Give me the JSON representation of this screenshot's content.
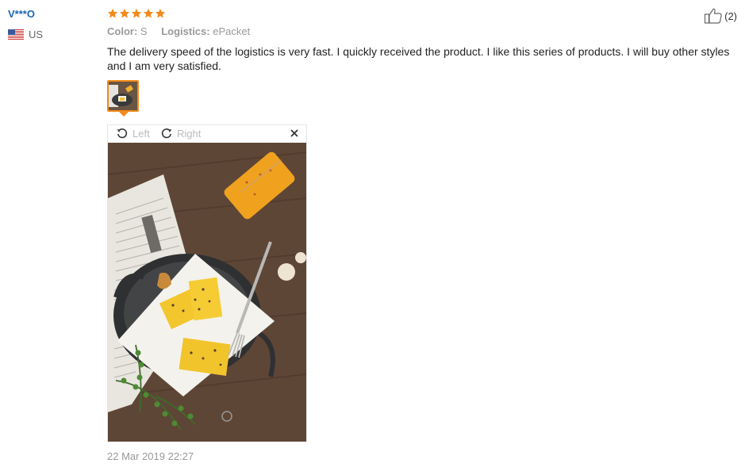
{
  "user": {
    "name": "V***O",
    "country": "US",
    "flag": "us-flag-icon"
  },
  "rating": {
    "stars": 5,
    "max": 5,
    "color": "#f28a1c"
  },
  "meta": {
    "color_label": "Color:",
    "color_value": "S",
    "logistics_label": "Logistics:",
    "logistics_value": "ePacket"
  },
  "review": {
    "text": "The delivery speed of the logistics is very fast. I quickly received the product. I like this series of products. I will buy other styles and I am very satisfied."
  },
  "helpful": {
    "count": "(2)",
    "icon": "thumbs-up-icon"
  },
  "viewer": {
    "rotate_left": "Left",
    "rotate_right": "Right",
    "close_icon": "close-icon"
  },
  "timestamp": "22 Mar 2019 22:27",
  "colors": {
    "accent": "#f28a1c",
    "username": "#1a66b3",
    "muted": "#999999"
  }
}
